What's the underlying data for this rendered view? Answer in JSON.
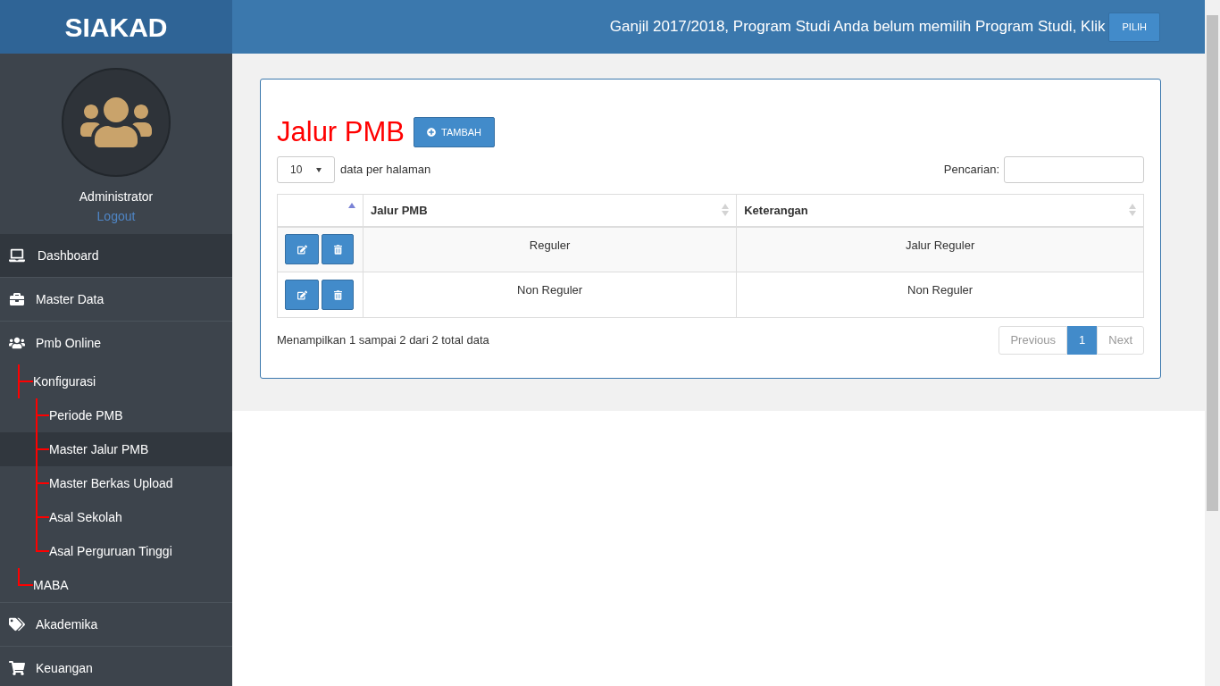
{
  "brand": "SIAKAD",
  "user": {
    "name": "Administrator",
    "logout": "Logout"
  },
  "menu": [
    {
      "label": "Dashboard",
      "selected": true
    },
    {
      "label": "Master Data",
      "selected": false
    },
    {
      "label": "Pmb Online",
      "selected": false,
      "expanded": true,
      "children": [
        {
          "label": "Konfigurasi",
          "selected": false,
          "expanded": true,
          "children": [
            {
              "label": "Periode PMB",
              "selected": false
            },
            {
              "label": "Master Jalur PMB",
              "selected": true
            },
            {
              "label": "Master Berkas Upload",
              "selected": false
            },
            {
              "label": "Asal Sekolah",
              "selected": false
            },
            {
              "label": "Asal Perguruan Tinggi",
              "selected": false
            }
          ]
        },
        {
          "label": "MABA",
          "selected": false
        }
      ]
    },
    {
      "label": "Akademika",
      "selected": false
    },
    {
      "label": "Keuangan",
      "selected": false
    }
  ],
  "header": {
    "notice": "Ganjil 2017/2018, Program Studi Anda belum memilih Program Studi, Klik",
    "button": "PILIH"
  },
  "page": {
    "title": "Jalur PMB",
    "add_button": "TAMBAH",
    "page_size": "10",
    "page_size_label": "data per halaman",
    "search_label": "Pencarian:",
    "action_column": {
      "sorted": true
    },
    "columns": [
      {
        "label": "Jalur PMB",
        "sorted": false
      },
      {
        "label": "Keterangan",
        "sorted": false
      }
    ],
    "rows": [
      [
        "Reguler",
        "Jalur Reguler"
      ],
      [
        "Non Reguler",
        "Non Reguler"
      ]
    ],
    "info": "Menampilkan 1 sampai 2 dari 2 total data",
    "previous": {
      "label": "Previous",
      "disabled": true
    },
    "pages": [
      {
        "label": "1",
        "selected": true
      }
    ],
    "next": {
      "label": "Next",
      "disabled": true
    }
  }
}
